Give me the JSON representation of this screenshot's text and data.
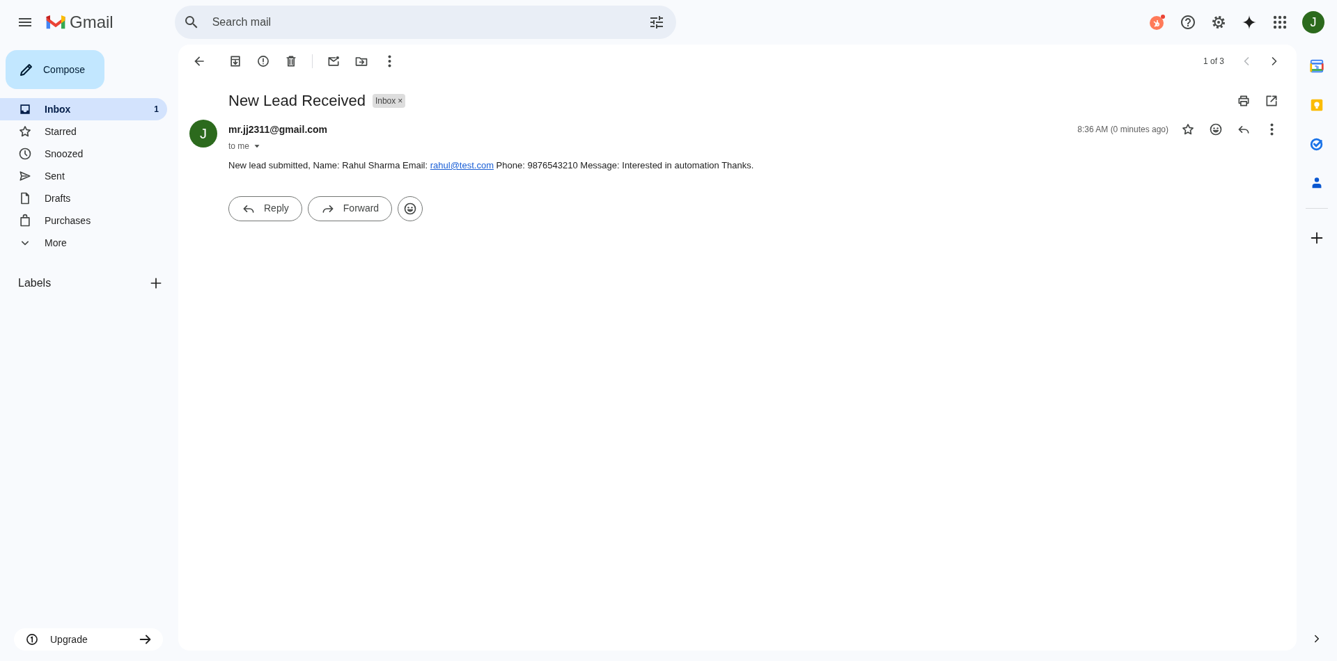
{
  "app": {
    "name": "Gmail"
  },
  "search": {
    "placeholder": "Search mail"
  },
  "account": {
    "initial": "J"
  },
  "compose": {
    "label": "Compose"
  },
  "nav": [
    {
      "kind": "inbox",
      "label": "Inbox",
      "count": "1",
      "selected": true
    },
    {
      "kind": "star",
      "label": "Starred",
      "selected": false
    },
    {
      "kind": "clock",
      "label": "Snoozed",
      "selected": false
    },
    {
      "kind": "send",
      "label": "Sent",
      "selected": false
    },
    {
      "kind": "draft",
      "label": "Drafts",
      "selected": false
    },
    {
      "kind": "bag",
      "label": "Purchases",
      "selected": false
    },
    {
      "kind": "chevron",
      "label": "More",
      "selected": false
    }
  ],
  "labels": {
    "title": "Labels"
  },
  "upgrade": {
    "label": "Upgrade"
  },
  "toolbar": {
    "pager": "1 of 3"
  },
  "message": {
    "subject": "New Lead Received",
    "tag": "Inbox",
    "tag_close": "×",
    "initial": "J",
    "sender": "mr.jj2311@gmail.com",
    "recipient": "to me",
    "time": "8:36 AM (0 minutes ago)",
    "starred": false,
    "body": [
      {
        "kind": "text",
        "text": "New lead submitted, Name: Rahul Sharma Email: "
      },
      {
        "kind": "link",
        "text": "rahul@test.com"
      },
      {
        "kind": "text",
        "text": " Phone: 9876543210 Message: Interested in automation Thanks."
      }
    ]
  },
  "actions": [
    {
      "kind": "reply",
      "label": "Reply"
    },
    {
      "kind": "forward",
      "label": "Forward"
    }
  ]
}
